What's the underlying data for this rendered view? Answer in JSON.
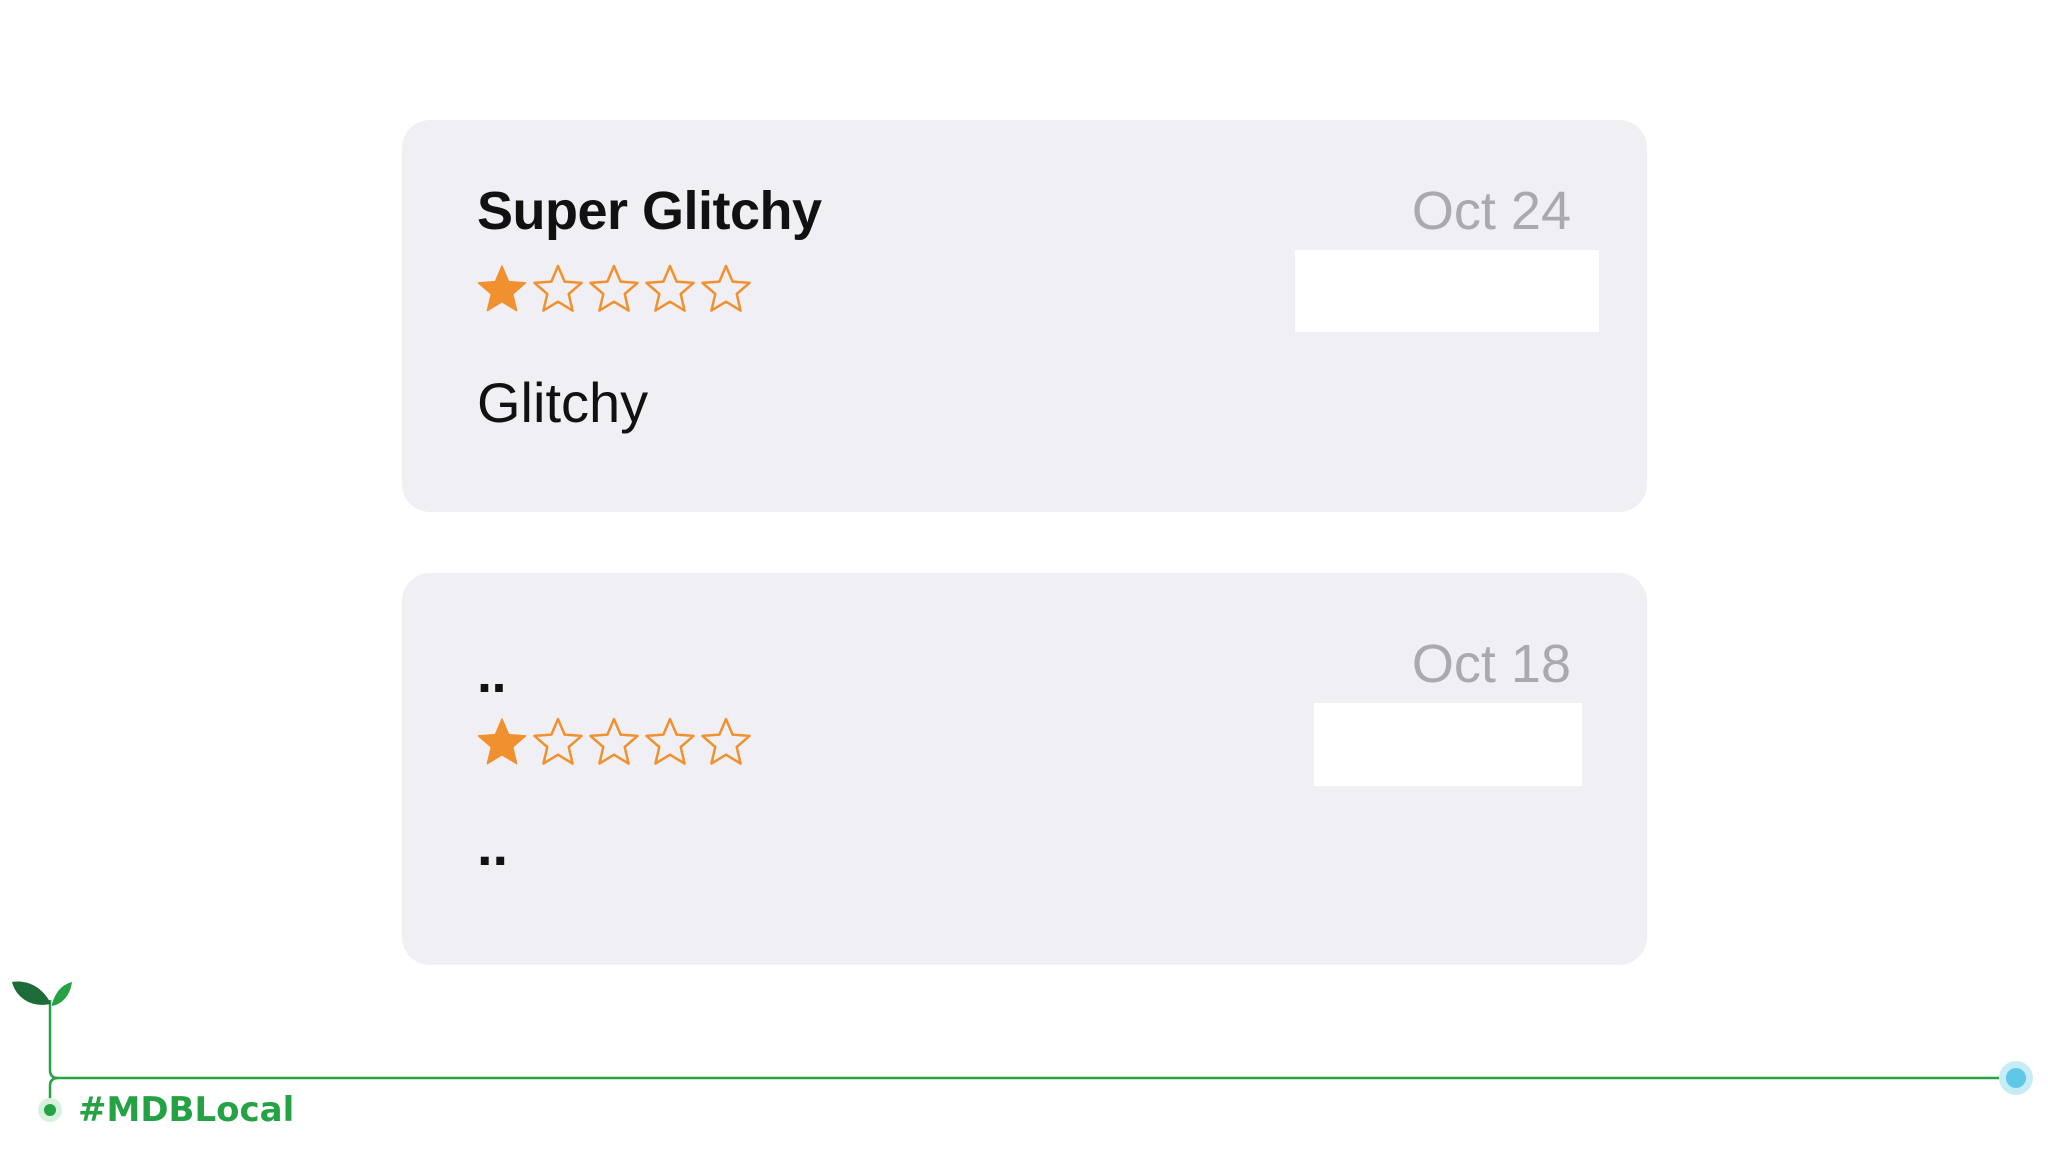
{
  "reviews": [
    {
      "title": "Super Glitchy",
      "date": "Oct 24",
      "rating": 1,
      "max_rating": 5,
      "body": "Glitchy"
    },
    {
      "title": "..",
      "date": "Oct 18",
      "rating": 1,
      "max_rating": 5,
      "body": ".."
    }
  ],
  "branding": {
    "hashtag": "#MDBLocal"
  },
  "colors": {
    "star": "#f0902e",
    "card_background": "#f0f0f4",
    "date_text": "#a9a9ae",
    "brand_green": "#25a244",
    "timeline_dot": "#5ec8e6"
  }
}
